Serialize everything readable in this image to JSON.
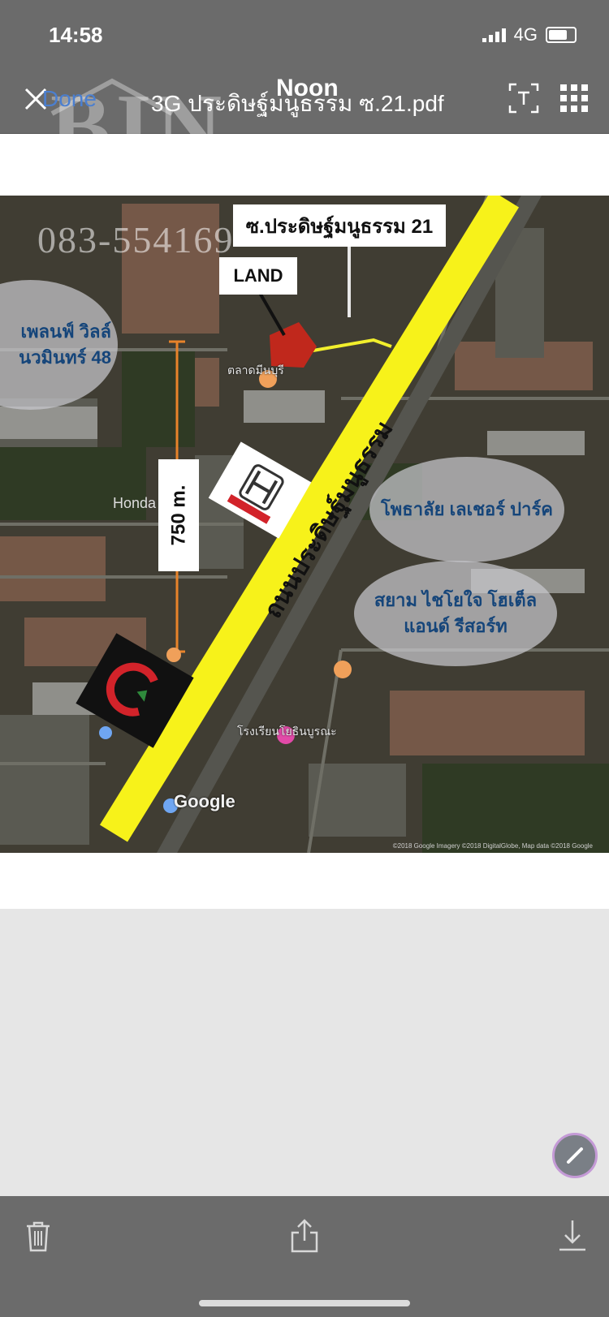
{
  "status": {
    "time": "14:58",
    "network": "4G"
  },
  "nav": {
    "done_label": "Done",
    "title": "3G ประดิษฐ์มนูธรรม ซ.21.pdf",
    "watermark": "BIN",
    "noon": "Noon"
  },
  "map": {
    "soi_label": "ซ.ประดิษฐ์มนูธรรม 21",
    "land_label": "LAND",
    "distance_label": "750 m.",
    "phone_watermark": "083-554169",
    "road_label": "ถนนประดิษฐ์มนูธรรม",
    "left_oval": {
      "line1": "เพลนฟ์ วิลล์",
      "line2": "นวมินทร์ 48"
    },
    "oval_1": {
      "line1": "โพธาลัย เลเชอร์ ปาร์ค"
    },
    "oval_2": {
      "line1": "สยาม ไชโยใจ โฮเต็ล",
      "line2": "แอนด์ รีสอร์ท"
    },
    "honda_small": "Honda",
    "google": "Google",
    "copyright": "©2018 Google Imagery ©2018 DigitalGlobe, Map data ©2018 Google",
    "place_1": "ตลาดมีนบุรี",
    "place_2": "โรงเรียนโยธินบูรณะ"
  },
  "colors": {
    "road_yellow": "#f7f21a",
    "chrome": "#6b6b6b",
    "land_red": "#c0281c",
    "distance_orange": "#e8832a"
  }
}
